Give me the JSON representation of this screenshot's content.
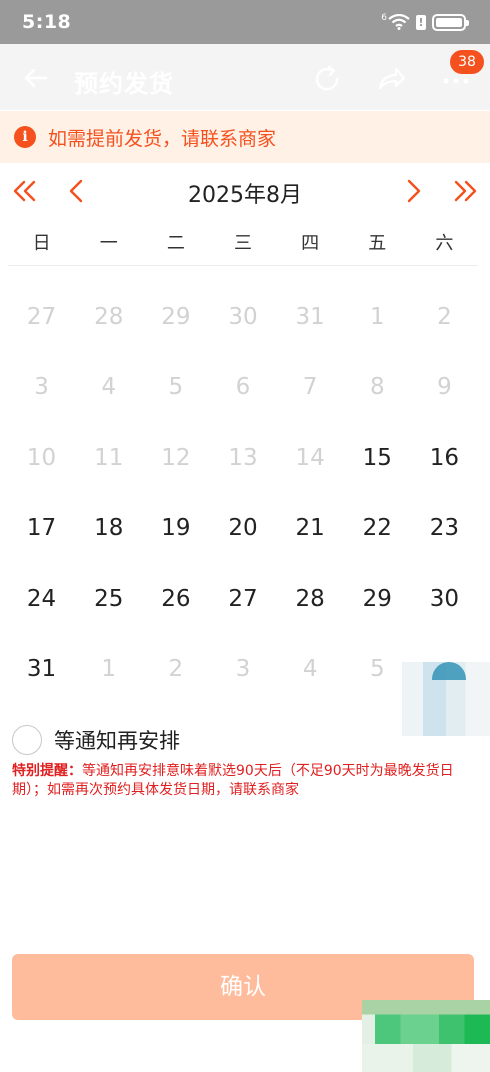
{
  "status_bar": {
    "time": "5:18",
    "signal_label": "6"
  },
  "header": {
    "title": "预约发货",
    "badge_count": "38",
    "icons": [
      "back-arrow-icon",
      "refresh-icon",
      "share-icon",
      "more-icon"
    ]
  },
  "notice": {
    "icon": "info-icon",
    "text": "如需提前发货，请联系商家"
  },
  "calendar": {
    "month_title": "2025年8月",
    "weekdays": [
      "日",
      "一",
      "二",
      "三",
      "四",
      "五",
      "六"
    ],
    "days": [
      {
        "label": "27",
        "enabled": false
      },
      {
        "label": "28",
        "enabled": false
      },
      {
        "label": "29",
        "enabled": false
      },
      {
        "label": "30",
        "enabled": false
      },
      {
        "label": "31",
        "enabled": false
      },
      {
        "label": "1",
        "enabled": false
      },
      {
        "label": "2",
        "enabled": false
      },
      {
        "label": "3",
        "enabled": false
      },
      {
        "label": "4",
        "enabled": false
      },
      {
        "label": "5",
        "enabled": false
      },
      {
        "label": "6",
        "enabled": false
      },
      {
        "label": "7",
        "enabled": false
      },
      {
        "label": "8",
        "enabled": false
      },
      {
        "label": "9",
        "enabled": false
      },
      {
        "label": "10",
        "enabled": false
      },
      {
        "label": "11",
        "enabled": false
      },
      {
        "label": "12",
        "enabled": false
      },
      {
        "label": "13",
        "enabled": false
      },
      {
        "label": "14",
        "enabled": false
      },
      {
        "label": "15",
        "enabled": true
      },
      {
        "label": "16",
        "enabled": true
      },
      {
        "label": "17",
        "enabled": true
      },
      {
        "label": "18",
        "enabled": true
      },
      {
        "label": "19",
        "enabled": true
      },
      {
        "label": "20",
        "enabled": true
      },
      {
        "label": "21",
        "enabled": true
      },
      {
        "label": "22",
        "enabled": true
      },
      {
        "label": "23",
        "enabled": true
      },
      {
        "label": "24",
        "enabled": true
      },
      {
        "label": "25",
        "enabled": true
      },
      {
        "label": "26",
        "enabled": true
      },
      {
        "label": "27",
        "enabled": true
      },
      {
        "label": "28",
        "enabled": true
      },
      {
        "label": "29",
        "enabled": true
      },
      {
        "label": "30",
        "enabled": true
      },
      {
        "label": "31",
        "enabled": true
      },
      {
        "label": "1",
        "enabled": false
      },
      {
        "label": "2",
        "enabled": false
      },
      {
        "label": "3",
        "enabled": false
      },
      {
        "label": "4",
        "enabled": false
      },
      {
        "label": "5",
        "enabled": false
      },
      {
        "label": "",
        "enabled": false
      }
    ]
  },
  "wait_option": {
    "label": "等通知再安排",
    "checked": false
  },
  "special_notice": {
    "prefix": "特别提醒：",
    "text": "等通知再安排意味着默选90天后（不足90天时为最晚发货日期）；如需再次预约具体发货日期，请联系商家"
  },
  "confirm": {
    "label": "确认"
  },
  "colors": {
    "accent": "#f4511e",
    "notice_bg": "#fff1e6",
    "confirm_disabled": "#ffbc9c",
    "warning_text": "#e02020"
  }
}
